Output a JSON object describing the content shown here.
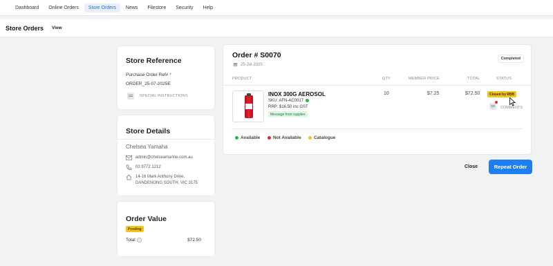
{
  "nav": {
    "items": [
      "Dashboard",
      "Online Orders",
      "Store Orders",
      "News",
      "Filestore",
      "Security",
      "Help"
    ],
    "active": "Store Orders"
  },
  "subheader": {
    "title": "Store Orders",
    "view_label": "View"
  },
  "store_reference": {
    "heading": "Store Reference",
    "po_label": "Purchase Order Ref#",
    "required_mark": "*",
    "po_value": "ORDER_25-07-2025E",
    "special_instructions": "SPECIAL INSTRUCTIONS"
  },
  "store_details": {
    "heading": "Store Details",
    "name": "Chelsea Yamaha",
    "email": "admin@chelseamarine.com.au",
    "phone": "03 9772 1212",
    "address_line1": "14-16 Mark Anthony Drive,",
    "address_line2": "DANDENONG SOUTH, VIC 3175"
  },
  "order_value": {
    "heading": "Order Value",
    "status": "Pending",
    "total_label": "Total",
    "total_value": "$72.50",
    "status_color": "#f3c41b"
  },
  "order": {
    "title": "Order # S0070",
    "date": "25-Jul-2025",
    "status": "Completed",
    "columns": {
      "product": "PRODUCT",
      "qty": "QTY",
      "member_price": "MEMBER PRICE",
      "total": "TOTAL",
      "status": "STATUS"
    },
    "line": {
      "name": "INOX 300G AEROSOL",
      "sku": "SKU:  AFN-AC0017",
      "rrp": "RRP: $16.50 inc GST",
      "message_badge": "Message from supplier",
      "qty": "10",
      "member_price": "$7.25",
      "total": "$72.50",
      "status": "Closed by RBB",
      "comments": "COMMENTS"
    },
    "legend": [
      {
        "label": "Available",
        "color": "#2bb34a"
      },
      {
        "label": "Not Available",
        "color": "#e0293b"
      },
      {
        "label": "Catalogue",
        "color": "#f3c41b"
      }
    ]
  },
  "actions": {
    "close": "Close",
    "repeat": "Repeat Order",
    "repeat_color": "#1e7ef2"
  }
}
